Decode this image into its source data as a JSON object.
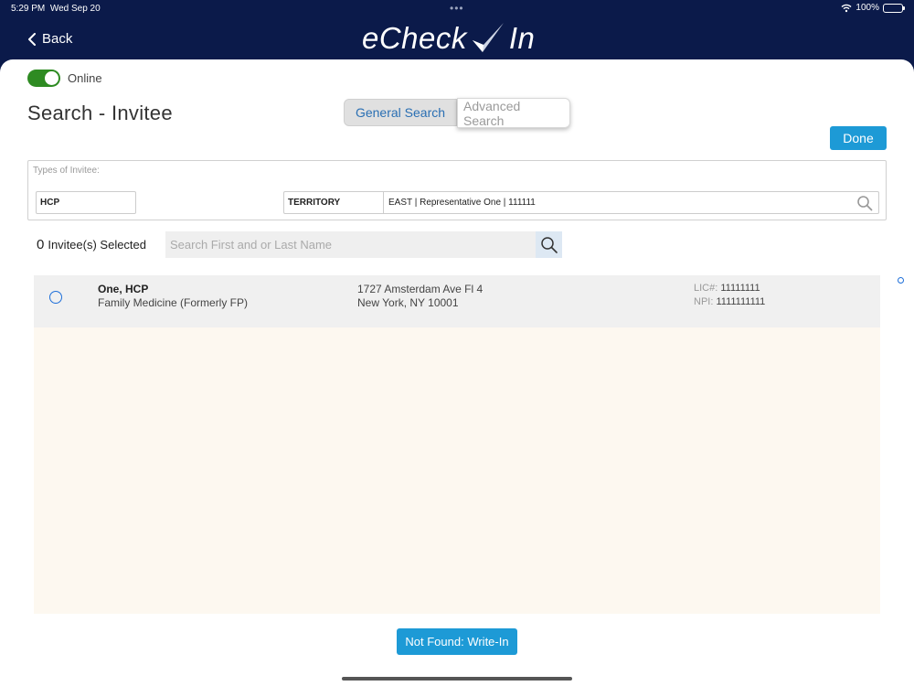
{
  "status_bar": {
    "time": "5:29 PM",
    "date": "Wed Sep 20",
    "battery": "100%",
    "battery_level": 1.0
  },
  "nav": {
    "back_label": "Back",
    "logo_left": "eCheck",
    "logo_right": "In"
  },
  "online_toggle": {
    "label": "Online",
    "on": true,
    "color": "#2e8b22"
  },
  "page_title": "Search - Invitee",
  "tabs": {
    "general": "General Search",
    "advanced": "Advanced Search",
    "active": "general"
  },
  "done_label": "Done",
  "filters": {
    "types_label": "Types of Invitee:",
    "type_value": "HCP",
    "territory_label": "TERRITORY",
    "territory_value": "EAST | Representative One | 111111"
  },
  "selection": {
    "count": "0",
    "label": "Invitee(s) Selected"
  },
  "name_search": {
    "placeholder": "Search First and or Last Name",
    "value": ""
  },
  "invitees": [
    {
      "name": "One, HCP",
      "specialty": "Family Medicine (Formerly FP)",
      "address_line1": "1727 Amsterdam Ave Fl 4",
      "address_line2": "New York, NY 10001",
      "lic_label": "LIC#:",
      "lic": "11111111",
      "npi_label": "NPI:",
      "npi": "1111111111",
      "selected": false
    }
  ],
  "write_in_label": "Not Found: Write-In",
  "colors": {
    "nav": "#0b1a4a",
    "accent": "#1d9ad6",
    "list_bg": "#fdf8f0"
  },
  "icons": {
    "back": "chevron-left-icon",
    "search": "magnifier-icon",
    "wifi": "wifi-icon",
    "battery": "battery-icon",
    "check": "checkmark-icon"
  }
}
